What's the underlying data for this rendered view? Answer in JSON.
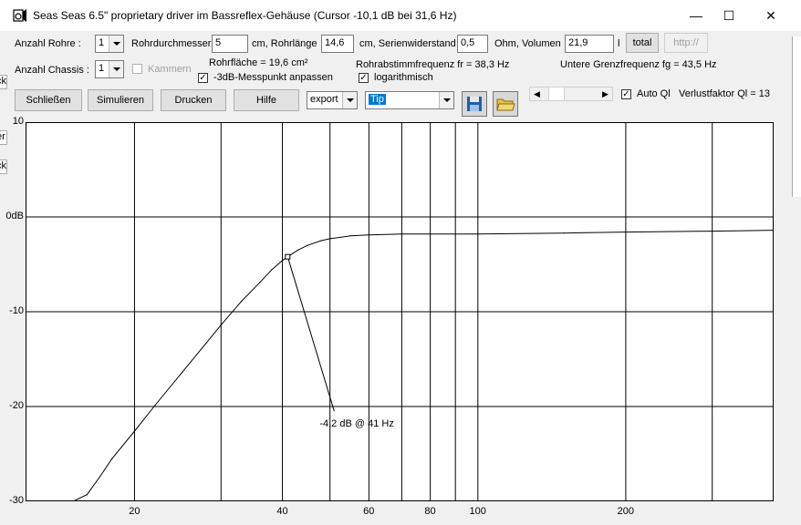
{
  "window": {
    "title": "Seas Seas 6.5\" proprietary driver im Bassreflex-Gehäuse (Cursor -10,1 dB bei 31,6 Hz)",
    "icon": "speaker-app-icon",
    "minimize_glyph": "—",
    "maximize_glyph": "☐",
    "close_glyph": "✕"
  },
  "row1": {
    "anzahl_rohre_label": "Anzahl Rohre :",
    "anzahl_rohre_value": "1",
    "rohrdurchmesser_label": "Rohrdurchmesser",
    "rohrdurchmesser_value": "5",
    "rohrlaenge_label": "cm, Rohrlänge",
    "rohrlaenge_value": "14,6",
    "serienwiderstand_label": "cm, Serienwiderstand",
    "serienwiderstand_value": "0,5",
    "volumen_label": "Ohm, Volumen",
    "volumen_value": "21,9",
    "volumen_unit": "l",
    "total_button": "total",
    "http_button": "http://"
  },
  "row2": {
    "anzahl_chassis_label": "Anzahl Chassis :",
    "anzahl_chassis_value": "1",
    "kammern_label": "Kammern",
    "rohrflaeche_text": "Rohrfläche = 19,6 cm²",
    "messpunkt_label": "-3dB-Messpunkt anpassen",
    "messpunkt_checked": "✓",
    "abstimm_text": "Rohrabstimmfrequenz fr = 38,3 Hz",
    "log_label": "logarithmisch",
    "log_checked": "✓",
    "grenz_text": "Untere Grenzfrequenz fg = 43,5 Hz"
  },
  "row3": {
    "schliessen": "Schließen",
    "simulieren": "Simulieren",
    "drucken": "Drucken",
    "hilfe": "Hilfe",
    "export_value": "export",
    "tip_value": "Tip",
    "auto_ql_label": "Auto Ql",
    "auto_ql_checked": "✓",
    "verlust_text": "Verlustfaktor Ql = 13"
  },
  "colors": {
    "window_bg": "#f0f0f0",
    "plot_bg": "#ffffff",
    "grid": "#000000",
    "curve": "#000000",
    "highlight": "#0078d7"
  },
  "edge_labels": [
    "ck",
    "er",
    "ck"
  ],
  "chart_data": {
    "type": "line",
    "title": "",
    "xlabel": "",
    "ylabel": "",
    "x_scale": "log",
    "xlim": [
      12,
      400
    ],
    "ylim": [
      -30,
      10
    ],
    "x_ticks": [
      {
        "value": 20,
        "label": "20"
      },
      {
        "value": 40,
        "label": "40"
      },
      {
        "value": 60,
        "label": "60"
      },
      {
        "value": 80,
        "label": "80"
      },
      {
        "value": 100,
        "label": "100"
      },
      {
        "value": 200,
        "label": "200"
      }
    ],
    "x_gridlines": [
      20,
      30,
      40,
      50,
      60,
      70,
      80,
      90,
      100,
      200,
      300
    ],
    "y_ticks": [
      {
        "value": 10,
        "label": "10"
      },
      {
        "value": 0,
        "label": "0dB"
      },
      {
        "value": -10,
        "label": "-10"
      },
      {
        "value": -20,
        "label": "-20"
      },
      {
        "value": -30,
        "label": "-30"
      }
    ],
    "grid": true,
    "series": [
      {
        "x": [
          15,
          16,
          17,
          18,
          20,
          22,
          25,
          28,
          30,
          33,
          36,
          38,
          40,
          41,
          43,
          45,
          48,
          50,
          55,
          60,
          70,
          80,
          100,
          150,
          200,
          300,
          400
        ],
        "y": [
          -30.0,
          -29.3,
          -27.4,
          -25.5,
          -22.6,
          -19.9,
          -16.4,
          -13.3,
          -11.4,
          -8.9,
          -6.9,
          -5.6,
          -4.6,
          -4.2,
          -3.5,
          -3.0,
          -2.5,
          -2.3,
          -2.0,
          -1.9,
          -1.8,
          -1.8,
          -1.8,
          -1.7,
          -1.6,
          -1.5,
          -1.4
        ]
      }
    ],
    "annotation": {
      "text": "-4,2 dB @  41 Hz",
      "point_x": 41,
      "point_y": -4.2,
      "leader_end_x": 51,
      "leader_end_y": -20.5
    }
  }
}
